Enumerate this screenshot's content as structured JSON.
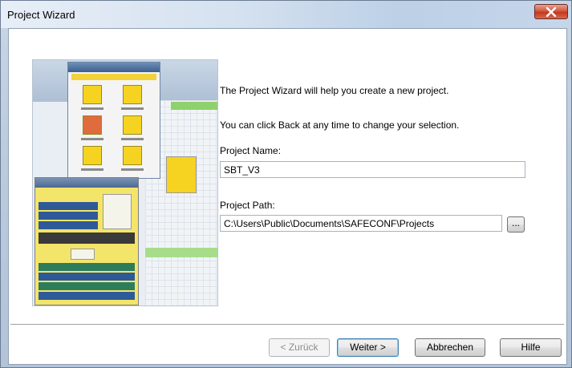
{
  "window": {
    "title": "Project Wizard",
    "close_icon": "close-x-icon"
  },
  "wizard": {
    "intro": "The Project Wizard will help you create a new project.",
    "hint": "You can click Back at any time to change your selection.",
    "project_name_label": "Project Name:",
    "project_name_value": "SBT_V3",
    "project_path_label": "Project Path:",
    "project_path_value": "C:\\Users\\Public\\Documents\\SAFECONF\\Projects",
    "browse_label": "..."
  },
  "buttons": {
    "back": "< Zurück",
    "next": "Weiter >",
    "cancel": "Abbrechen",
    "help": "Hilfe"
  },
  "colors": {
    "close_button": "#c2391f",
    "default_button_border": "#3c7fb1",
    "preview_accent_yellow": "#f5d320"
  }
}
